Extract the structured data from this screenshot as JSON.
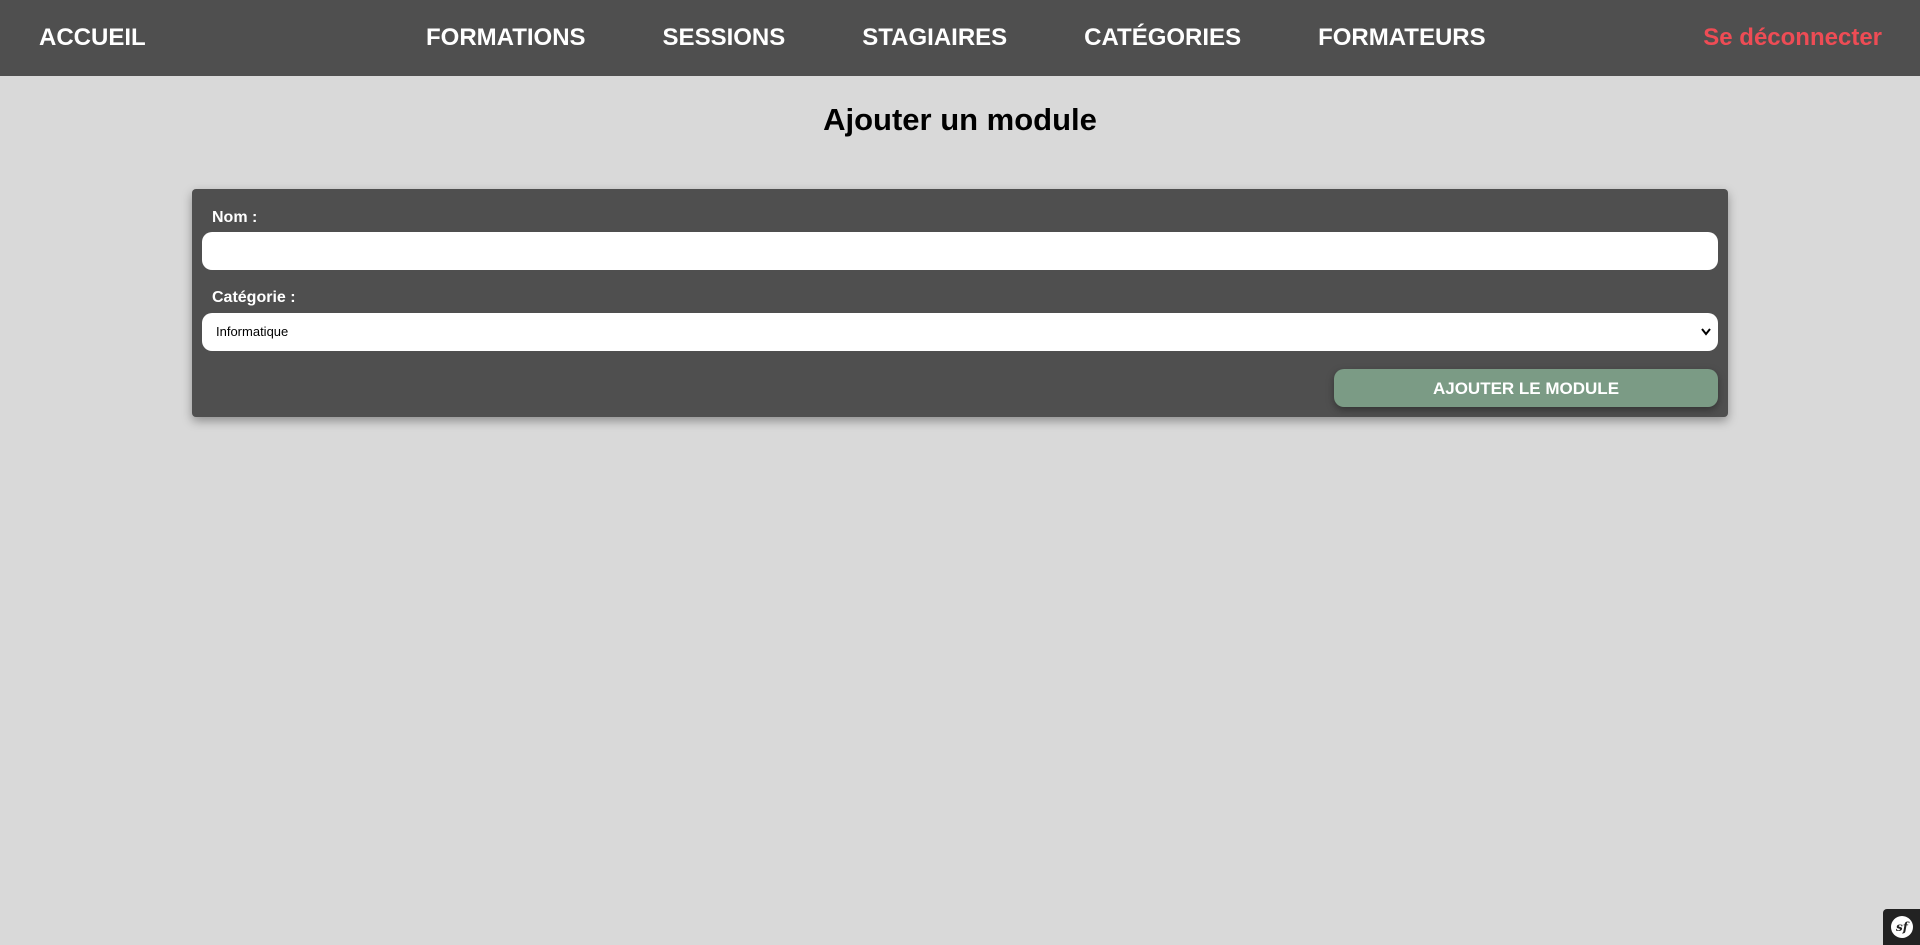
{
  "nav": {
    "home": "ACCUEIL",
    "links": [
      "FORMATIONS",
      "SESSIONS",
      "STAGIAIRES",
      "CATÉGORIES",
      "FORMATEURS"
    ],
    "logout": "Se déconnecter"
  },
  "page": {
    "title": "Ajouter un module"
  },
  "form": {
    "name_label": "Nom :",
    "name_value": "",
    "category_label": "Catégorie :",
    "category_selected": "Informatique",
    "submit_label": "AJOUTER LE MODULE"
  },
  "symfony_toolbar": {
    "logo_glyph": "sf"
  },
  "colors": {
    "navbar_bg": "#4f4f4f",
    "page_bg": "#d9d9d9",
    "logout": "#ee4c55",
    "submit_bg": "#7b9b85"
  }
}
